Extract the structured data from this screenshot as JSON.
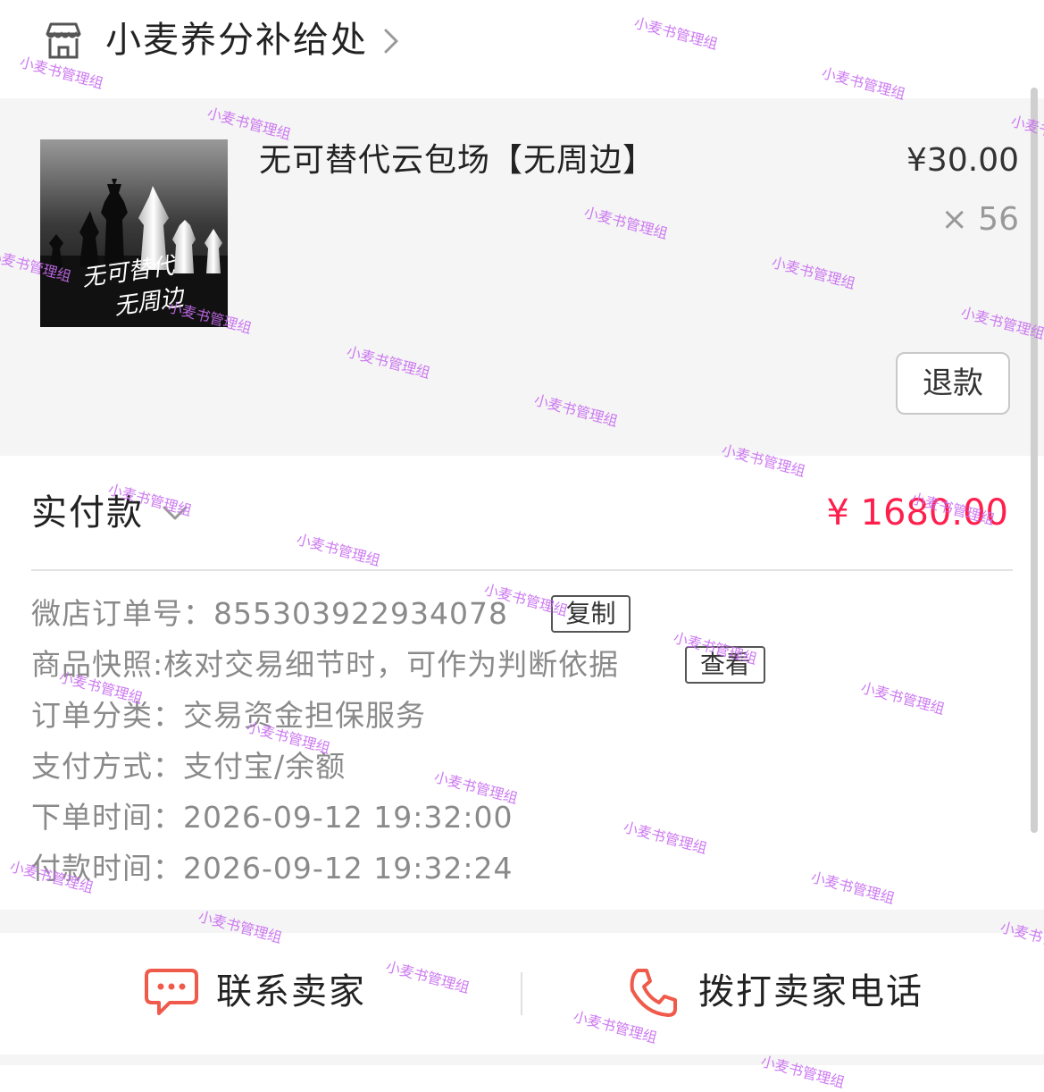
{
  "shop": {
    "name": "小麦养分补给处",
    "icon": "store-icon"
  },
  "product": {
    "title": "无可替代云包场【无周边】",
    "price": "¥30.00",
    "quantity": "× 56",
    "image_text_line1": "无可替代",
    "image_text_line2": "无周边",
    "refund_label": "退款"
  },
  "payment": {
    "label": "实付款",
    "amount": "¥ 1680.00",
    "accent_color": "#ff1f4d"
  },
  "order_info": {
    "order_no_label": "微店订单号：",
    "order_no_value": "855303922934078",
    "copy_label": "复制",
    "snapshot_label": "商品快照:",
    "snapshot_value": "核对交易细节时，可作为判断依据",
    "view_label": "查看",
    "category_label": "订单分类：",
    "category_value": "交易资金担保服务",
    "pay_method_label": "支付方式：",
    "pay_method_value": "支付宝/余额",
    "order_time_label": "下单时间：",
    "order_time_value": "2026-09-12 19:32:00",
    "pay_time_label": "付款时间：",
    "pay_time_value": "2026-09-12 19:32:24"
  },
  "bottom_bar": {
    "contact_label": "联系卖家",
    "call_label": "拨打卖家电话",
    "icon_color": "#f05a4a"
  },
  "watermark": {
    "text": "小麦书管理组",
    "color": "#c86cf0"
  }
}
